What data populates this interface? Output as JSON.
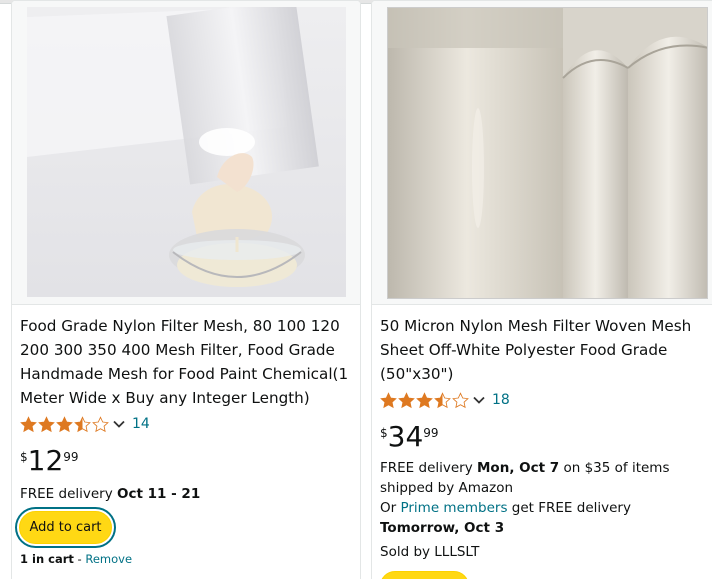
{
  "products": [
    {
      "title": "Food Grade Nylon Filter Mesh, 80 100 120 200 300 350 400 Mesh Filter, Food Grade Handmade Mesh for Food Paint Chemical(1 Meter Wide x Buy any Integer Length) (200…",
      "rating_value": 3.5,
      "rating_count": "14",
      "price_currency": "$",
      "price_whole": "12",
      "price_fraction": "99",
      "delivery_prefix": "FREE delivery ",
      "delivery_date": "Oct 11 - 21",
      "add_to_cart": "Add to cart",
      "in_cart": "1 in cart",
      "in_cart_sep": " - ",
      "remove": "Remove"
    },
    {
      "title": "50 Micron Nylon Mesh Filter Woven Mesh Sheet Off-White Polyester Food Grade (50\"x30\")",
      "rating_value": 3.5,
      "rating_count": "18",
      "price_currency": "$",
      "price_whole": "34",
      "price_fraction": "99",
      "delivery_prefix": "FREE delivery ",
      "delivery_date": "Mon, Oct 7",
      "delivery_suffix": " on $35 of items shipped by Amazon",
      "prime_prefix": "Or ",
      "prime_link": "Prime members",
      "prime_middle": " get FREE delivery ",
      "prime_date": "Tomorrow, Oct 3",
      "sold_by": "Sold by LLLSLT"
    }
  ],
  "colors": {
    "star": "#de7921",
    "link": "#007185",
    "button": "#ffd814"
  }
}
